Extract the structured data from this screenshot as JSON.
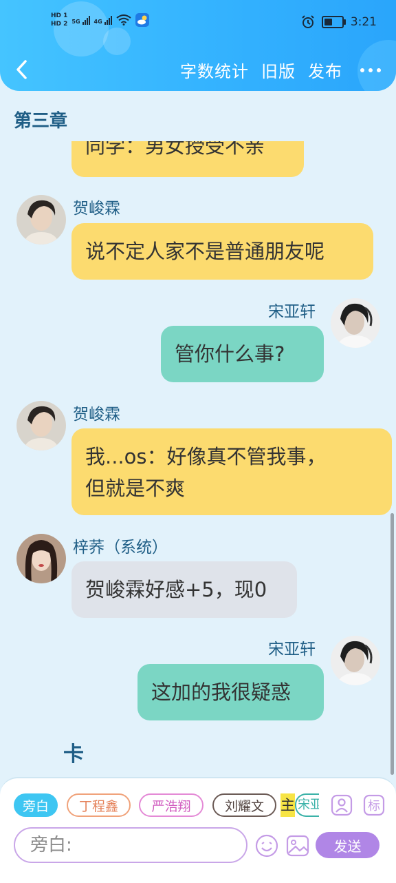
{
  "status_bar": {
    "network_1": "HD 1",
    "network_2": "HD 2",
    "sig_1": "5G",
    "sig_2": "4G",
    "time": "3:21",
    "battery_level": 0.45
  },
  "nav": {
    "word_count": "字数统计",
    "old_version": "旧版",
    "publish": "发布"
  },
  "chapter_title": "第三章",
  "messages": [
    {
      "speaker": "",
      "text": "同学：男女授受不亲"
    },
    {
      "speaker": "贺峻霖",
      "text": "说不定人家不是普通朋友呢"
    },
    {
      "speaker": "宋亚轩",
      "text": "管你什么事?"
    },
    {
      "speaker": "贺峻霖",
      "text_line1": "我...os：好像真不管我事，",
      "text_line2": "但就是不爽"
    },
    {
      "speaker": "梓荞（系统）",
      "text": "贺峻霖好感+5，现0"
    },
    {
      "speaker": "宋亚轩",
      "text": "这加的我很疑惑"
    }
  ],
  "card_label": "卡",
  "roles": {
    "narration": "旁白",
    "ding": "丁程鑫",
    "yan": "严浩翔",
    "liu": "刘耀文",
    "main": "主",
    "song_partial": "宋亚"
  },
  "input": {
    "placeholder": "旁白:"
  },
  "send": "发送",
  "colors": {
    "header": "#35b4ff",
    "bubble_yellow": "#fcdb6f",
    "bubble_green": "#7bd6c4",
    "bubble_gray": "#dfe3ea",
    "name_color": "#1f5e86",
    "send": "#b086e6"
  }
}
